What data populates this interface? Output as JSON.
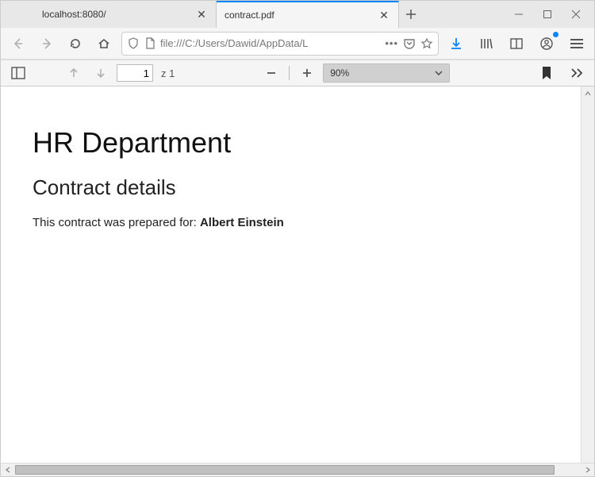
{
  "tabs": {
    "items": [
      {
        "label": "localhost:8080/"
      },
      {
        "label": "contract.pdf"
      }
    ]
  },
  "urlbar": {
    "text": "file:///C:/Users/Dawid/AppData/L"
  },
  "pdf_toolbar": {
    "page_value": "1",
    "page_count_prefix": "z",
    "page_count": "1",
    "zoom_label": "90%"
  },
  "document": {
    "h1": "HR Department",
    "h2": "Contract details",
    "para_prefix": "This contract was prepared for: ",
    "para_bold": "Albert Einstein"
  }
}
